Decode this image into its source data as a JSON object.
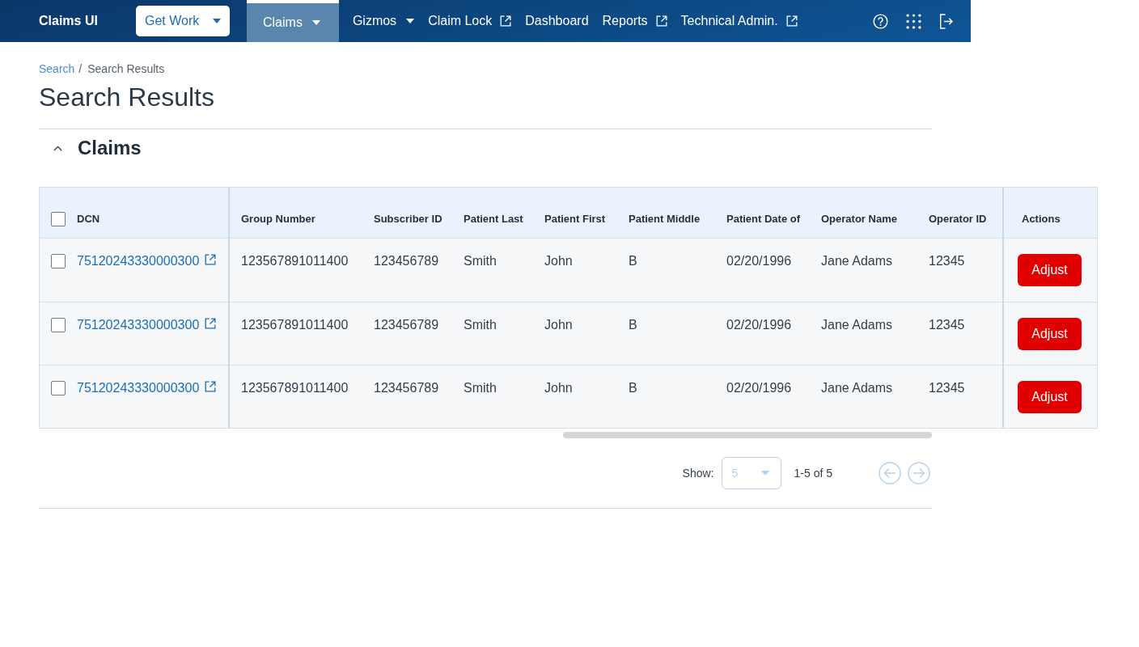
{
  "app": {
    "title": "Claims UI",
    "get_work": "Get Work"
  },
  "nav": [
    {
      "label": "Claims",
      "kind": "dropdown",
      "selected": true
    },
    {
      "label": "Gizmos",
      "kind": "dropdown",
      "selected": false
    },
    {
      "label": "Claim Lock",
      "kind": "external",
      "selected": false
    },
    {
      "label": "Dashboard",
      "kind": "link",
      "selected": false
    },
    {
      "label": "Reports",
      "kind": "external",
      "selected": false
    },
    {
      "label": "Technical Admin.",
      "kind": "external",
      "selected": false
    }
  ],
  "breadcrumb": {
    "items": [
      {
        "label": "Search",
        "kind": "link"
      },
      {
        "label": "Search Results",
        "kind": "current"
      }
    ],
    "separator": "/"
  },
  "page_title": "Search Results",
  "section": {
    "title": "Claims",
    "expanded": true
  },
  "table": {
    "select_all_checked": false,
    "columns": [
      "DCN",
      "Group Number",
      "Subscriber ID",
      "Patient Last",
      "Patient First",
      "Patient Middle",
      "Patient Date of",
      "Operator Name",
      "Operator ID",
      "Actions"
    ],
    "rows": [
      {
        "checked": false,
        "cells": [
          "75120243330000300",
          "123567891011400",
          "123456789",
          "Smith",
          "John",
          "B",
          "02/20/1996",
          "Jane Adams",
          "12345",
          "Adjust"
        ]
      },
      {
        "checked": false,
        "cells": [
          "75120243330000300",
          "123567891011400",
          "123456789",
          "Smith",
          "John",
          "B",
          "02/20/1996",
          "Jane Adams",
          "12345",
          "Adjust"
        ]
      },
      {
        "checked": false,
        "cells": [
          "75120243330000300",
          "123567891011400",
          "123456789",
          "Smith",
          "John",
          "B",
          "02/20/1996",
          "Jane Adams",
          "12345",
          "Adjust"
        ]
      }
    ]
  },
  "pagination": {
    "show_label": "Show:",
    "page_size": "5",
    "page_size_disabled": true,
    "range": "1-5 of 5",
    "prev_disabled": true,
    "next_disabled": true
  }
}
